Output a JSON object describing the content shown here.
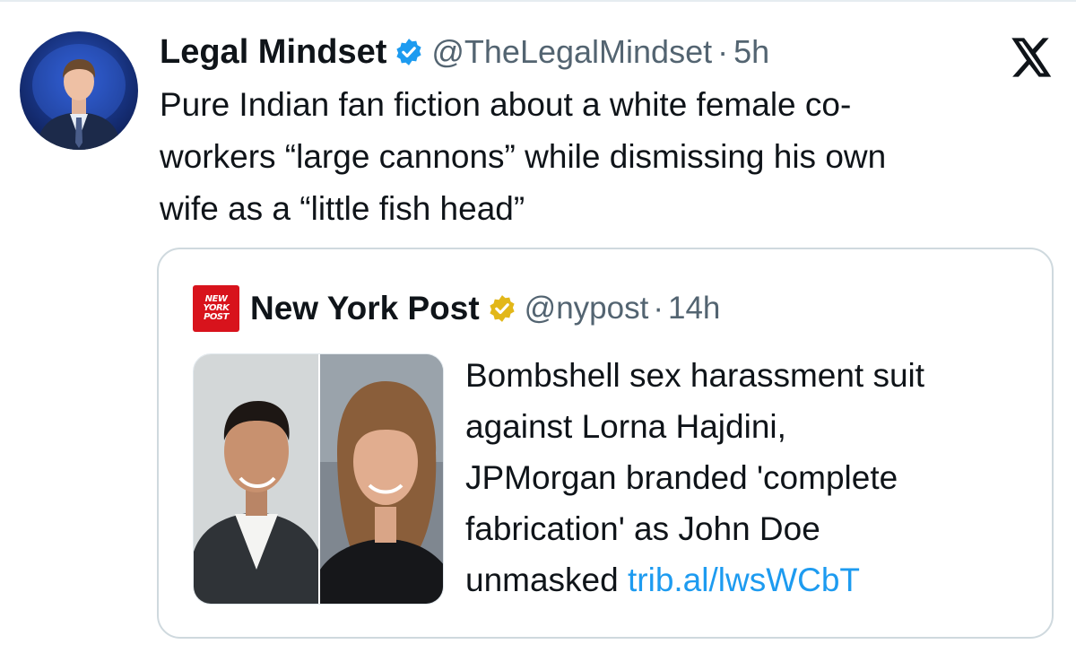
{
  "tweet": {
    "author_name": "Legal Mindset",
    "handle": "@TheLegalMindset",
    "separator": "·",
    "time": "5h",
    "text_lines": [
      "Pure Indian fan fiction about a white female co-",
      "workers “large cannons” while dismissing his own",
      "wife as a “little fish head”"
    ]
  },
  "quote": {
    "author_name": "New York Post",
    "logo_lines": [
      "NEW",
      "YORK",
      "POST"
    ],
    "handle": "@nypost",
    "separator": "·",
    "time": "14h",
    "text_lines": [
      "Bombshell sex harassment suit",
      "against Lorna Hajdini,",
      "JPMorgan branded 'complete",
      "fabrication' as John Doe"
    ],
    "last_line_prefix": "unmasked ",
    "link": "trib.al/lwsWCbT"
  },
  "icons": {
    "verified_blue": "verified-badge-icon",
    "verified_gold": "verified-org-badge-icon",
    "platform_logo": "x-logo-icon"
  },
  "colors": {
    "text": "#0f1419",
    "secondary": "#536471",
    "link": "#1d9bf0",
    "verified_blue": "#1d9bf0",
    "verified_gold": "#e2b719",
    "nypost_red": "#d8131c",
    "border": "#cfd9de"
  }
}
